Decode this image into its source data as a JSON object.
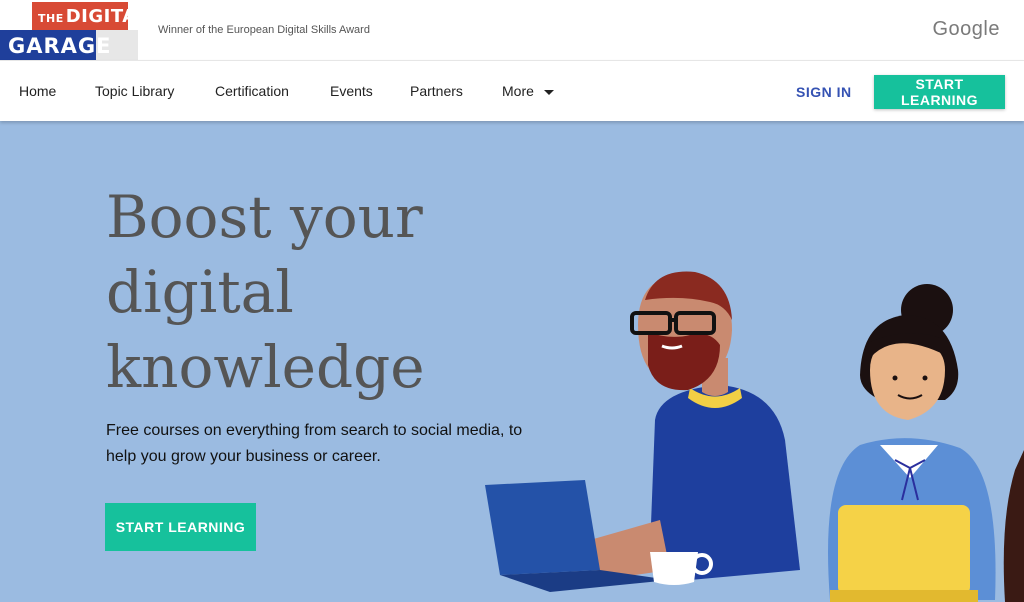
{
  "brand": {
    "logo_line1_small": "THE",
    "logo_line1": "DIGITAL",
    "logo_line2": "GARAGE",
    "award_text": "Winner of the European Digital Skills Award",
    "google_label": "Google",
    "colors": {
      "red": "#d84a35",
      "blue": "#1f3f9b"
    }
  },
  "nav": {
    "items": [
      {
        "label": "Home"
      },
      {
        "label": "Topic Library"
      },
      {
        "label": "Certification"
      },
      {
        "label": "Events"
      },
      {
        "label": "Partners"
      },
      {
        "label": "More"
      }
    ],
    "sign_in": "SIGN IN",
    "start_learning": "START LEARNING"
  },
  "hero": {
    "title": "Boost your digital knowledge",
    "subtitle": "Free courses on everything from search to social media, to help you grow your business or career.",
    "cta": "START LEARNING",
    "background": "#9bbbe1",
    "accent": "#16c19c"
  }
}
